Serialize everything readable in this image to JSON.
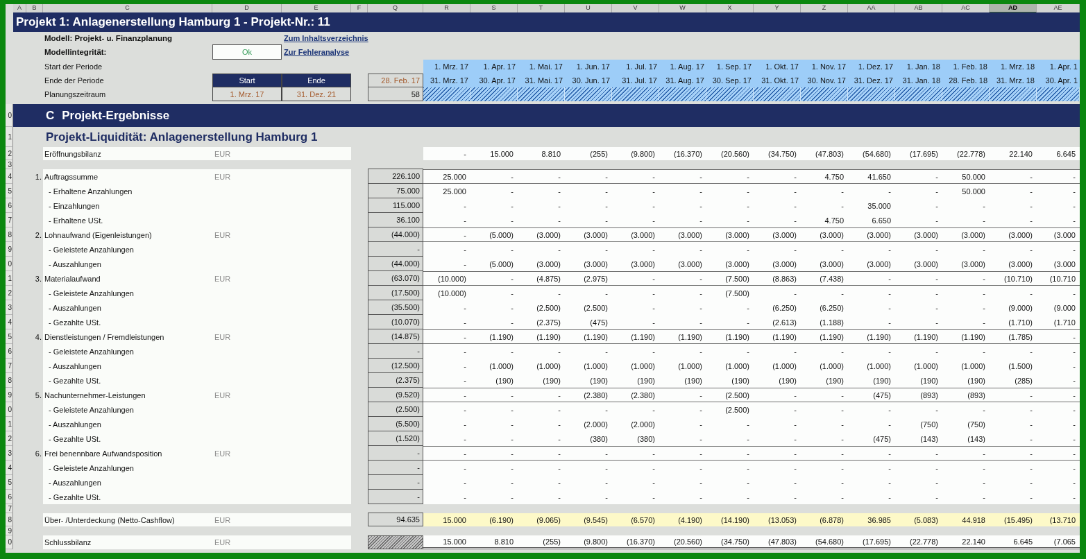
{
  "column_headers": [
    {
      "label": "A",
      "selected": false
    },
    {
      "label": "B",
      "selected": false
    },
    {
      "label": "C",
      "selected": false
    },
    {
      "label": "D",
      "selected": false
    },
    {
      "label": "E",
      "selected": false
    },
    {
      "label": "F",
      "selected": false
    },
    {
      "label": "Q",
      "selected": false
    },
    {
      "label": "R",
      "selected": false
    },
    {
      "label": "S",
      "selected": false
    },
    {
      "label": "T",
      "selected": false
    },
    {
      "label": "U",
      "selected": false
    },
    {
      "label": "V",
      "selected": false
    },
    {
      "label": "W",
      "selected": false
    },
    {
      "label": "X",
      "selected": false
    },
    {
      "label": "Y",
      "selected": false
    },
    {
      "label": "Z",
      "selected": false
    },
    {
      "label": "AA",
      "selected": false
    },
    {
      "label": "AB",
      "selected": false
    },
    {
      "label": "AC",
      "selected": false
    },
    {
      "label": "AD",
      "selected": true
    },
    {
      "label": "AE",
      "selected": false
    }
  ],
  "title": "Projekt 1: Anlagenerstellung Hamburg 1 - Projekt-Nr.: 11",
  "model": {
    "label": "Modell: Projekt- u. Finanzplanung",
    "link": "Zum Inhaltsverzeichnis"
  },
  "integrity": {
    "label": "Modellintegrität:",
    "status": "Ok",
    "link": "Zur Fehleranalyse"
  },
  "period": {
    "start_label": "Start der Periode",
    "end_label": "Ende der Periode",
    "planning_label": "Planungszeitraum",
    "start_heading": "Start",
    "end_heading": "Ende",
    "start_date": "1. Mrz. 17",
    "end_date": "31. Dez. 21",
    "prior_end": "28. Feb. 17",
    "months_count": "58",
    "months": [
      {
        "start": "1. Mrz. 17",
        "end": "31. Mrz. 17"
      },
      {
        "start": "1. Apr. 17",
        "end": "30. Apr. 17"
      },
      {
        "start": "1. Mai. 17",
        "end": "31. Mai. 17"
      },
      {
        "start": "1. Jun. 17",
        "end": "30. Jun. 17"
      },
      {
        "start": "1. Jul. 17",
        "end": "31. Jul. 17"
      },
      {
        "start": "1. Aug. 17",
        "end": "31. Aug. 17"
      },
      {
        "start": "1. Sep. 17",
        "end": "30. Sep. 17"
      },
      {
        "start": "1. Okt. 17",
        "end": "31. Okt. 17"
      },
      {
        "start": "1. Nov. 17",
        "end": "30. Nov. 17"
      },
      {
        "start": "1. Dez. 17",
        "end": "31. Dez. 17"
      },
      {
        "start": "1. Jan. 18",
        "end": "31. Jan. 18"
      },
      {
        "start": "1. Feb. 18",
        "end": "28. Feb. 18"
      },
      {
        "start": "1. Mrz. 18",
        "end": "31. Mrz. 18"
      },
      {
        "start": "1. Apr. 1",
        "end": "30. Apr. 1"
      }
    ]
  },
  "section": {
    "row_number": "0",
    "letter": "C",
    "title": "Projekt-Ergebnisse"
  },
  "liquidity": {
    "row_number": "1",
    "title": "Projekt-Liquidität: Anlagenerstellung Hamburg 1"
  },
  "rows": [
    {
      "row_number": "2",
      "kind": "opening",
      "label": "Eröffnungsbilanz",
      "unit": "EUR",
      "values": [
        "-",
        "15.000",
        "8.810",
        "(255)",
        "(9.800)",
        "(16.370)",
        "(20.560)",
        "(34.750)",
        "(47.803)",
        "(54.680)",
        "(17.695)",
        "(22.778)",
        "22.140",
        "6.645"
      ]
    },
    {
      "row_number": "3",
      "kind": "blank"
    },
    {
      "row_number": "4",
      "kind": "group",
      "number": "1.",
      "label": "Auftragssumme",
      "unit": "EUR",
      "total": "226.100",
      "values": [
        "25.000",
        "-",
        "-",
        "-",
        "-",
        "-",
        "-",
        "-",
        "4.750",
        "41.650",
        "-",
        "50.000",
        "-",
        "-"
      ]
    },
    {
      "row_number": "5",
      "kind": "item",
      "label": "- Erhaltene Anzahlungen",
      "total": "75.000",
      "values": [
        "25.000",
        "-",
        "-",
        "-",
        "-",
        "-",
        "-",
        "-",
        "-",
        "-",
        "-",
        "50.000",
        "-",
        "-"
      ]
    },
    {
      "row_number": "6",
      "kind": "item",
      "label": "- Einzahlungen",
      "total": "115.000",
      "values": [
        "-",
        "-",
        "-",
        "-",
        "-",
        "-",
        "-",
        "-",
        "-",
        "35.000",
        "-",
        "-",
        "-",
        "-"
      ]
    },
    {
      "row_number": "7",
      "kind": "item",
      "label": "- Erhaltene USt.",
      "total": "36.100",
      "values": [
        "-",
        "-",
        "-",
        "-",
        "-",
        "-",
        "-",
        "-",
        "4.750",
        "6.650",
        "-",
        "-",
        "-",
        "-"
      ]
    },
    {
      "row_number": "8",
      "kind": "group",
      "number": "2.",
      "label": "Lohnaufwand (Eigenleistungen)",
      "unit": "EUR",
      "total": "(44.000)",
      "values": [
        "-",
        "(5.000)",
        "(3.000)",
        "(3.000)",
        "(3.000)",
        "(3.000)",
        "(3.000)",
        "(3.000)",
        "(3.000)",
        "(3.000)",
        "(3.000)",
        "(3.000)",
        "(3.000)",
        "(3.000"
      ]
    },
    {
      "row_number": "9",
      "kind": "item",
      "label": "- Geleistete Anzahlungen",
      "total": "-",
      "values": [
        "-",
        "-",
        "-",
        "-",
        "-",
        "-",
        "-",
        "-",
        "-",
        "-",
        "-",
        "-",
        "-",
        "-"
      ]
    },
    {
      "row_number": "0",
      "kind": "item",
      "label": "- Auszahlungen",
      "total": "(44.000)",
      "values": [
        "-",
        "(5.000)",
        "(3.000)",
        "(3.000)",
        "(3.000)",
        "(3.000)",
        "(3.000)",
        "(3.000)",
        "(3.000)",
        "(3.000)",
        "(3.000)",
        "(3.000)",
        "(3.000)",
        "(3.000"
      ]
    },
    {
      "row_number": "1",
      "kind": "group",
      "number": "3.",
      "label": "Materialaufwand",
      "unit": "EUR",
      "total": "(63.070)",
      "values": [
        "(10.000)",
        "-",
        "(4.875)",
        "(2.975)",
        "-",
        "-",
        "(7.500)",
        "(8.863)",
        "(7.438)",
        "-",
        "-",
        "-",
        "(10.710)",
        "(10.710"
      ]
    },
    {
      "row_number": "2",
      "kind": "item",
      "label": "- Geleistete Anzahlungen",
      "total": "(17.500)",
      "values": [
        "(10.000)",
        "-",
        "-",
        "-",
        "-",
        "-",
        "(7.500)",
        "-",
        "-",
        "-",
        "-",
        "-",
        "-",
        "-"
      ]
    },
    {
      "row_number": "3",
      "kind": "item",
      "label": "- Auszahlungen",
      "total": "(35.500)",
      "values": [
        "-",
        "-",
        "(2.500)",
        "(2.500)",
        "-",
        "-",
        "-",
        "(6.250)",
        "(6.250)",
        "-",
        "-",
        "-",
        "(9.000)",
        "(9.000"
      ]
    },
    {
      "row_number": "4",
      "kind": "item",
      "label": "- Gezahlte USt.",
      "total": "(10.070)",
      "values": [
        "-",
        "-",
        "(2.375)",
        "(475)",
        "-",
        "-",
        "-",
        "(2.613)",
        "(1.188)",
        "-",
        "-",
        "-",
        "(1.710)",
        "(1.710"
      ]
    },
    {
      "row_number": "5",
      "kind": "group",
      "number": "4.",
      "label": "Dienstleistungen / Fremdleistungen",
      "unit": "EUR",
      "total": "(14.875)",
      "values": [
        "-",
        "(1.190)",
        "(1.190)",
        "(1.190)",
        "(1.190)",
        "(1.190)",
        "(1.190)",
        "(1.190)",
        "(1.190)",
        "(1.190)",
        "(1.190)",
        "(1.190)",
        "(1.785)",
        "-"
      ]
    },
    {
      "row_number": "6",
      "kind": "item",
      "label": "- Geleistete Anzahlungen",
      "total": "-",
      "values": [
        "-",
        "-",
        "-",
        "-",
        "-",
        "-",
        "-",
        "-",
        "-",
        "-",
        "-",
        "-",
        "-",
        "-"
      ]
    },
    {
      "row_number": "7",
      "kind": "item",
      "label": "- Auszahlungen",
      "total": "(12.500)",
      "values": [
        "-",
        "(1.000)",
        "(1.000)",
        "(1.000)",
        "(1.000)",
        "(1.000)",
        "(1.000)",
        "(1.000)",
        "(1.000)",
        "(1.000)",
        "(1.000)",
        "(1.000)",
        "(1.500)",
        "-"
      ]
    },
    {
      "row_number": "8",
      "kind": "item",
      "label": "- Gezahlte USt.",
      "total": "(2.375)",
      "values": [
        "-",
        "(190)",
        "(190)",
        "(190)",
        "(190)",
        "(190)",
        "(190)",
        "(190)",
        "(190)",
        "(190)",
        "(190)",
        "(190)",
        "(285)",
        "-"
      ]
    },
    {
      "row_number": "9",
      "kind": "group",
      "number": "5.",
      "label": "Nachunternehmer-Leistungen",
      "unit": "EUR",
      "total": "(9.520)",
      "values": [
        "-",
        "-",
        "-",
        "(2.380)",
        "(2.380)",
        "-",
        "(2.500)",
        "-",
        "-",
        "(475)",
        "(893)",
        "(893)",
        "-",
        "-"
      ]
    },
    {
      "row_number": "0",
      "kind": "item",
      "label": "- Geleistete Anzahlungen",
      "total": "(2.500)",
      "values": [
        "-",
        "-",
        "-",
        "-",
        "-",
        "-",
        "(2.500)",
        "-",
        "-",
        "-",
        "-",
        "-",
        "-",
        "-"
      ]
    },
    {
      "row_number": "1",
      "kind": "item",
      "label": "- Auszahlungen",
      "total": "(5.500)",
      "values": [
        "-",
        "-",
        "-",
        "(2.000)",
        "(2.000)",
        "-",
        "-",
        "-",
        "-",
        "-",
        "(750)",
        "(750)",
        "-",
        "-"
      ]
    },
    {
      "row_number": "2",
      "kind": "item",
      "label": "- Gezahlte USt.",
      "total": "(1.520)",
      "values": [
        "-",
        "-",
        "-",
        "(380)",
        "(380)",
        "-",
        "-",
        "-",
        "-",
        "(475)",
        "(143)",
        "(143)",
        "-",
        "-"
      ]
    },
    {
      "row_number": "3",
      "kind": "group",
      "number": "6.",
      "label": "Frei benennbare Aufwandsposition",
      "unit": "EUR",
      "total": "-",
      "values": [
        "-",
        "-",
        "-",
        "-",
        "-",
        "-",
        "-",
        "-",
        "-",
        "-",
        "-",
        "-",
        "-",
        "-"
      ]
    },
    {
      "row_number": "4",
      "kind": "item",
      "label": "- Geleistete Anzahlungen",
      "total": "-",
      "values": [
        "-",
        "-",
        "-",
        "-",
        "-",
        "-",
        "-",
        "-",
        "-",
        "-",
        "-",
        "-",
        "-",
        "-"
      ]
    },
    {
      "row_number": "5",
      "kind": "item",
      "label": "- Auszahlungen",
      "total": "-",
      "values": [
        "-",
        "-",
        "-",
        "-",
        "-",
        "-",
        "-",
        "-",
        "-",
        "-",
        "-",
        "-",
        "-",
        "-"
      ]
    },
    {
      "row_number": "6",
      "kind": "item",
      "label": "- Gezahlte USt.",
      "total": "-",
      "values": [
        "-",
        "-",
        "-",
        "-",
        "-",
        "-",
        "-",
        "-",
        "-",
        "-",
        "-",
        "-",
        "-",
        "-"
      ]
    },
    {
      "row_number": "7",
      "kind": "blank"
    },
    {
      "row_number": "8",
      "kind": "cashflow",
      "label": "Über- /Unterdeckung (Netto-Cashflow)",
      "unit": "EUR",
      "total": "94.635",
      "values": [
        "15.000",
        "(6.190)",
        "(9.065)",
        "(9.545)",
        "(6.570)",
        "(4.190)",
        "(14.190)",
        "(13.053)",
        "(6.878)",
        "36.985",
        "(5.083)",
        "44.918",
        "(15.495)",
        "(13.710"
      ]
    },
    {
      "row_number": "9",
      "kind": "blank"
    },
    {
      "row_number": "0",
      "kind": "closing",
      "label": "Schlussbilanz",
      "unit": "EUR",
      "values": [
        "15.000",
        "8.810",
        "(255)",
        "(9.800)",
        "(16.370)",
        "(20.560)",
        "(34.750)",
        "(47.803)",
        "(54.680)",
        "(17.695)",
        "(22.778)",
        "22.140",
        "6.645",
        "(7.065"
      ]
    }
  ]
}
